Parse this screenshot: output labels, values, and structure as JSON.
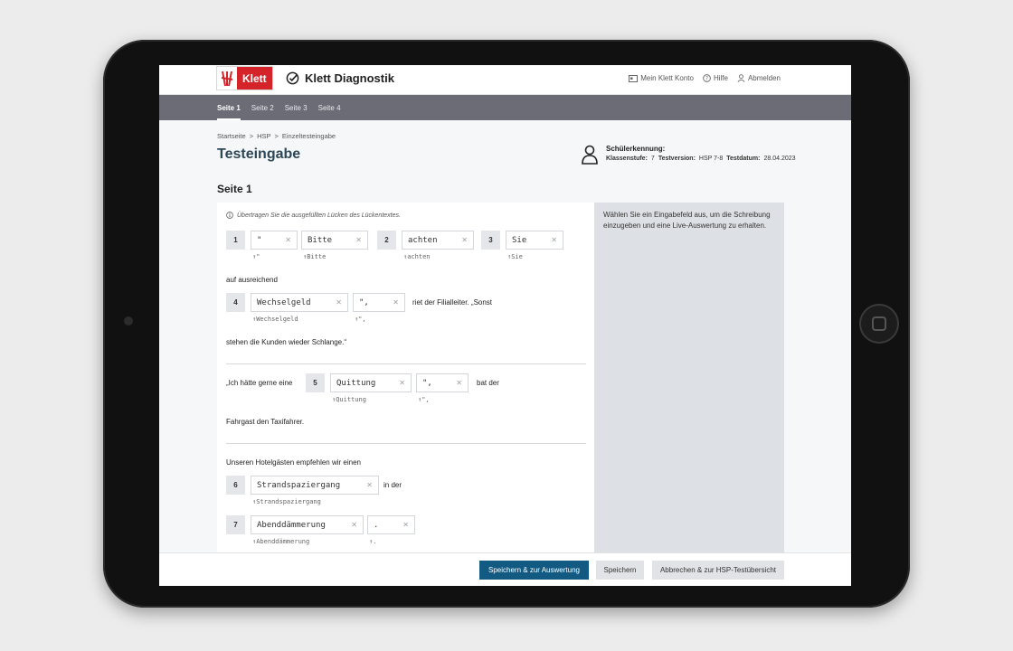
{
  "header": {
    "logo_text": "Klett",
    "brand": "Klett Diagnostik",
    "nav": [
      {
        "label": "Mein Klett Konto",
        "icon": "id-card-icon"
      },
      {
        "label": "Hilfe",
        "icon": "help-circle-icon"
      },
      {
        "label": "Abmelden",
        "icon": "user-icon"
      }
    ]
  },
  "tabs": [
    "Seite 1",
    "Seite 2",
    "Seite 3",
    "Seite 4"
  ],
  "active_tab": 0,
  "breadcrumb": [
    "Startseite",
    "HSP",
    "Einzeltesteingabe"
  ],
  "page_title": "Testeingabe",
  "student": {
    "label": "Schülerkennung:",
    "grade_label": "Klassenstufe:",
    "grade": "7",
    "version_label": "Testversion:",
    "version": "HSP 7-8",
    "date_label": "Testdatum:",
    "date": "28.04.2023"
  },
  "section_title": "Seite 1",
  "hint": "Übertragen Sie die ausgefüllten Lücken des Lückentextes.",
  "items": {
    "n1": "1",
    "f1a": "\"",
    "e1a": "↑\"",
    "f1b": "Bitte",
    "e1b": "↑Bitte",
    "n2": "2",
    "f2": "achten",
    "e2": "↑achten",
    "n3": "3",
    "f3": "Sie",
    "e3": "↑Sie",
    "t_auf": "auf ausreichend",
    "n4": "4",
    "f4a": "Wechselgeld",
    "e4a": "↑Wechselgeld",
    "f4b": "\",",
    "e4b": "↑\",",
    "t_riet": "riet der Filialleiter. „Sonst",
    "t_stehen": "stehen die Kunden wieder Schlange.“",
    "t_ich": "„Ich hätte gerne eine",
    "n5": "5",
    "f5a": "Quittung",
    "e5a": "↑Quittung",
    "f5b": "\",",
    "e5b": "↑\",",
    "t_bat": "bat der",
    "t_fahrgast": "Fahrgast den Taxifahrer.",
    "t_unseren": "Unseren Hotelgästen empfehlen wir einen",
    "n6": "6",
    "f6": "Strandspaziergang",
    "e6": "↑Strandspaziergang",
    "t_inder": "in der",
    "n7": "7",
    "f7a": "Abenddämmerung",
    "e7a": "↑Abenddämmerung",
    "f7b": ".",
    "e7b": "↑."
  },
  "side_text": "Wählen Sie ein Eingabefeld aus, um die Schreibung einzugeben und eine Live-Auswertung zu erhalten.",
  "footer": {
    "primary": "Speichern & zur Auswertung",
    "save": "Speichern",
    "cancel": "Abbrechen & zur HSP-Testübersicht"
  },
  "colors": {
    "brand_red": "#d5232a",
    "tab_bar": "#6b6c76",
    "primary_button": "#135a82",
    "title": "#2e4756"
  }
}
